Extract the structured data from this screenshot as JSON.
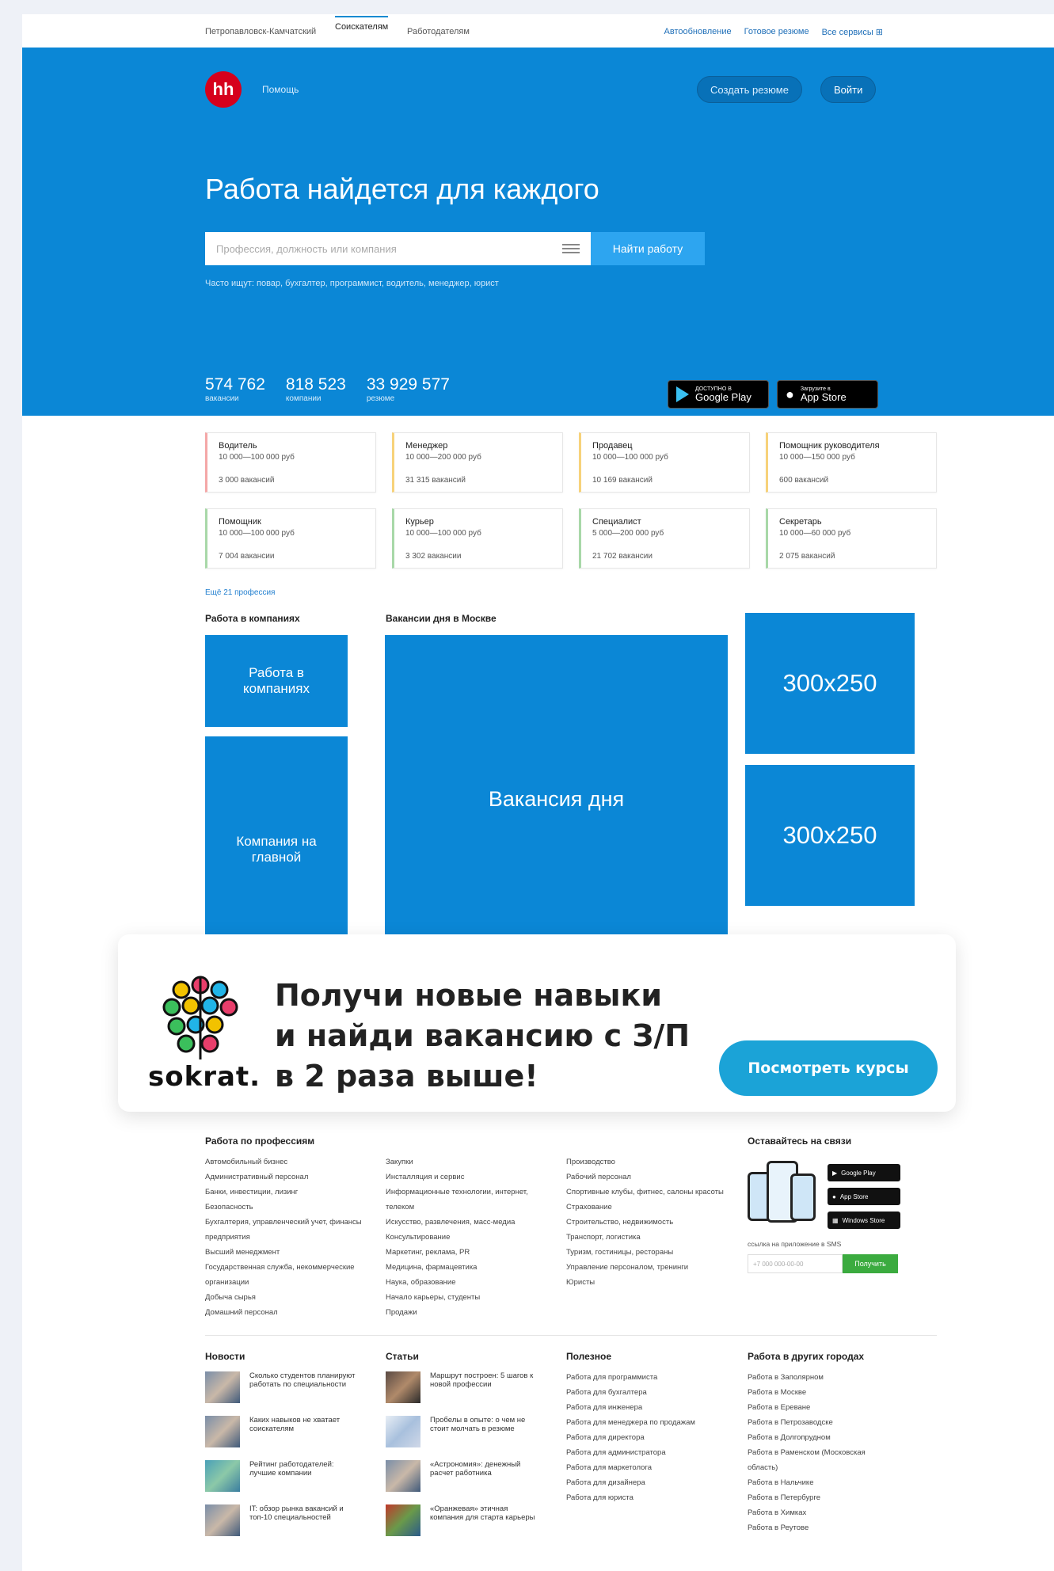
{
  "topnav": {
    "city": "Петропавловск-Камчатский",
    "tabs": [
      "Соискателям",
      "Работодателям"
    ],
    "links": [
      "Автообновление",
      "Готовое резюме",
      "Все сервисы"
    ]
  },
  "header": {
    "logo": "hh",
    "help": "Помощь",
    "create_resume": "Создать резюме",
    "login": "Войти"
  },
  "hero": {
    "title": "Работа найдется для каждого",
    "search_placeholder": "Профессия, должность или компания",
    "search_button": "Найти работу",
    "hint": "Часто ищут: повар, бухгалтер, программист, водитель, менеджер, юрист"
  },
  "stats": [
    {
      "value": "574 762",
      "label": "вакансии"
    },
    {
      "value": "818 523",
      "label": "компании"
    },
    {
      "value": "33 929 577",
      "label": "резюме"
    }
  ],
  "stores": {
    "google_small": "ДОСТУПНО В",
    "google": "Google Play",
    "apple_small": "Загрузите в",
    "apple": "App Store"
  },
  "professions": [
    {
      "name": "Водитель",
      "salary": "10 000—100 000 руб",
      "count": "3 000 вакансий",
      "accent": "#f4a7a7"
    },
    {
      "name": "Менеджер",
      "salary": "10 000—200 000 руб",
      "count": "31 315 вакансий",
      "accent": "#f7d27a"
    },
    {
      "name": "Продавец",
      "salary": "10 000—100 000 руб",
      "count": "10 169 вакансий",
      "accent": "#f7d27a"
    },
    {
      "name": "Помощник руководителя",
      "salary": "10 000—150 000 руб",
      "count": "600 вакансий",
      "accent": "#f7d27a"
    },
    {
      "name": "Помощник",
      "salary": "10 000—100 000 руб",
      "count": "7 004 вакансии",
      "accent": "#a8d8a8"
    },
    {
      "name": "Курьер",
      "salary": "10 000—100 000 руб",
      "count": "3 302 вакансии",
      "accent": "#a8d8a8"
    },
    {
      "name": "Специалист",
      "salary": "5 000—200 000 руб",
      "count": "21 702 вакансии",
      "accent": "#a8d8a8"
    },
    {
      "name": "Секретарь",
      "salary": "10 000—60 000 руб",
      "count": "2 075 вакансий",
      "accent": "#a8d8a8"
    }
  ],
  "more_professions": "Ещё 21 профессия",
  "companies": {
    "title": "Работа в компаниях",
    "block1": "Работа в компаниях",
    "block2": "Компания на главной"
  },
  "vacancy": {
    "title": "Вакансии дня в Москве",
    "block": "Вакансия дня"
  },
  "ads": [
    "300x250",
    "300x250"
  ],
  "banner": {
    "brand": "sokrat.",
    "line1": "Получи новые навыки",
    "line2": "и найди вакансию с З/П",
    "line3": "в 2 раза выше!",
    "button": "Посмотреть курсы",
    "dot_colors": [
      "#f2c200",
      "#e83e6b",
      "#21b5e8",
      "#3bbf5c",
      "#f2c200",
      "#21b5e8",
      "#e83e6b",
      "#3bbf5c",
      "#21b5e8",
      "#f2c200",
      "#3bbf5c",
      "#e83e6b"
    ]
  },
  "work_by_profession": {
    "title": "Работа по профессиям",
    "col1": [
      "Автомобильный бизнес",
      "Административный персонал",
      "Банки, инвестиции, лизинг",
      "Безопасность",
      "Бухгалтерия, управленческий учет, финансы предприятия",
      "Высший менеджмент",
      "Государственная служба, некоммерческие организации",
      "Добыча сырья",
      "Домашний персонал"
    ],
    "col2": [
      "Закупки",
      "Инсталляция и сервис",
      "Информационные технологии, интернет, телеком",
      "Искусство, развлечения, масс-медиа",
      "Консультирование",
      "Маркетинг, реклама, PR",
      "Медицина, фармацевтика",
      "Наука, образование",
      "Начало карьеры, студенты",
      "Продажи"
    ],
    "col3": [
      "Производство",
      "Рабочий персонал",
      "Спортивные клубы, фитнес, салоны красоты",
      "Страхование",
      "Строительство, недвижимость",
      "Транспорт, логистика",
      "Туризм, гостиницы, рестораны",
      "Управление персоналом, тренинги",
      "Юристы"
    ]
  },
  "stay_connected": {
    "title": "Оставайтесь на связи",
    "badges": [
      "Google Play",
      "App Store",
      "Windows Store"
    ],
    "link_text": "ссылка на приложение в SMS",
    "input_placeholder": "+7 000 000-00-00",
    "button": "Получить"
  },
  "news": {
    "title": "Новости",
    "items": [
      "Сколько студентов планируют работать по специальности",
      "Каких навыков не хватает соискателям",
      "Рейтинг работодателей: лучшие компании",
      "IT: обзор рынка вакансий и топ-10 специальностей"
    ]
  },
  "articles": {
    "title": "Статьи",
    "items": [
      "Маршрут построен: 5 шагов к новой профессии",
      "Пробелы в опыте: о чем не стоит молчать в резюме",
      "«Астрономия»: денежный расчет работника",
      "«Оранжевая» этичная компания для старта карьеры"
    ]
  },
  "useful": {
    "title": "Полезное",
    "items": [
      "Работа для программиста",
      "Работа для бухгалтера",
      "Работа для инженера",
      "Работа для менеджера по продажам",
      "Работа для директора",
      "Работа для администратора",
      "Работа для маркетолога",
      "Работа для дизайнера",
      "Работа для юриста"
    ]
  },
  "other_cities": {
    "title": "Работа в других городах",
    "items": [
      "Работа в Заполярном",
      "Работа в Москве",
      "Работа в Ереване",
      "Работа в Петрозаводске",
      "Работа в Долгопрудном",
      "Работа в Раменском (Московская область)",
      "Работа в Нальчике",
      "Работа в Петербурге",
      "Работа в Химках",
      "Работа в Реутове"
    ]
  }
}
